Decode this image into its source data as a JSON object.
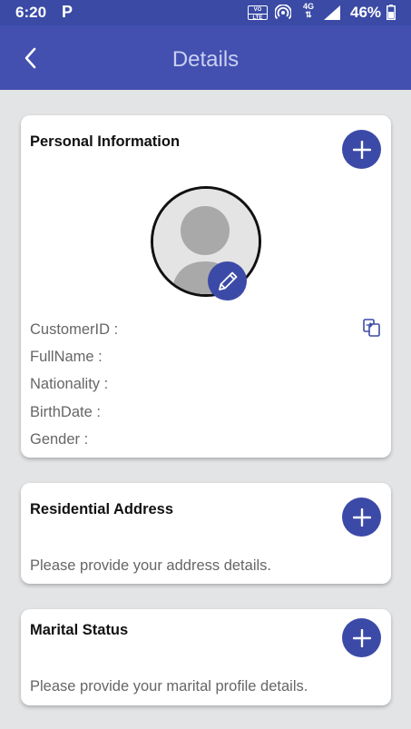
{
  "status_bar": {
    "time": "6:20",
    "app_indicator": "P",
    "volte_top": "VO",
    "volte_bottom": "LTE",
    "network": "4G",
    "battery": "46%"
  },
  "header": {
    "title": "Details"
  },
  "personal_info": {
    "title": "Personal Information",
    "fields": [
      {
        "label": "CustomerID :"
      },
      {
        "label": "FullName :"
      },
      {
        "label": "Nationality :"
      },
      {
        "label": "BirthDate :"
      },
      {
        "label": "Gender :"
      }
    ]
  },
  "residential_address": {
    "title": "Residential Address",
    "description": "Please provide your address details."
  },
  "marital_status": {
    "title": "Marital Status",
    "description": "Please provide your marital profile details."
  },
  "colors": {
    "app_bar": "#4350b0",
    "status_bar": "#3a4aa5",
    "accent": "#3c4aa7",
    "background": "#e3e4e6"
  },
  "icons": [
    "back-icon",
    "plus-icon",
    "pencil-icon",
    "copy-icon",
    "avatar-placeholder-icon",
    "hotspot-icon",
    "signal-icon",
    "battery-icon"
  ]
}
